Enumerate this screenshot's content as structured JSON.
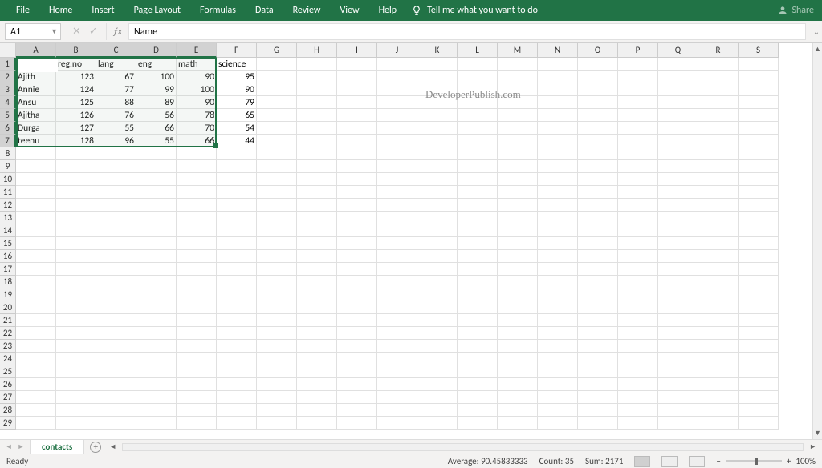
{
  "ribbon": {
    "tabs": [
      "File",
      "Home",
      "Insert",
      "Page Layout",
      "Formulas",
      "Data",
      "Review",
      "View",
      "Help"
    ],
    "tell_me": "Tell me what you want to do",
    "share": "Share"
  },
  "namebox": {
    "value": "A1"
  },
  "formula_bar": {
    "value": "Name"
  },
  "columns": [
    "A",
    "B",
    "C",
    "D",
    "E",
    "F",
    "G",
    "H",
    "I",
    "J",
    "K",
    "L",
    "M",
    "N",
    "O",
    "P",
    "Q",
    "R",
    "S"
  ],
  "selected_cols": [
    "A",
    "B",
    "C",
    "D",
    "E"
  ],
  "selected_rows": [
    1,
    2,
    3,
    4,
    5,
    6,
    7
  ],
  "row_count": 29,
  "sheet": {
    "active_tab": "contacts"
  },
  "chart_data": {
    "type": "table",
    "headers": [
      "Name",
      "reg.no",
      "lang",
      "eng",
      "math",
      "science"
    ],
    "rows": [
      [
        "Ajith",
        123,
        67,
        100,
        90,
        95
      ],
      [
        "Annie",
        124,
        77,
        99,
        100,
        90
      ],
      [
        "Ansu",
        125,
        88,
        89,
        90,
        79
      ],
      [
        "Ajitha",
        126,
        76,
        56,
        78,
        65
      ],
      [
        "Durga",
        127,
        55,
        66,
        70,
        54
      ],
      [
        "teenu",
        128,
        96,
        55,
        66,
        44
      ]
    ]
  },
  "watermark": "DeveloperPublish.com",
  "status": {
    "ready": "Ready",
    "average_label": "Average:",
    "average": "90.45833333",
    "count_label": "Count:",
    "count": "35",
    "sum_label": "Sum:",
    "sum": "2171",
    "zoom": "100%"
  }
}
